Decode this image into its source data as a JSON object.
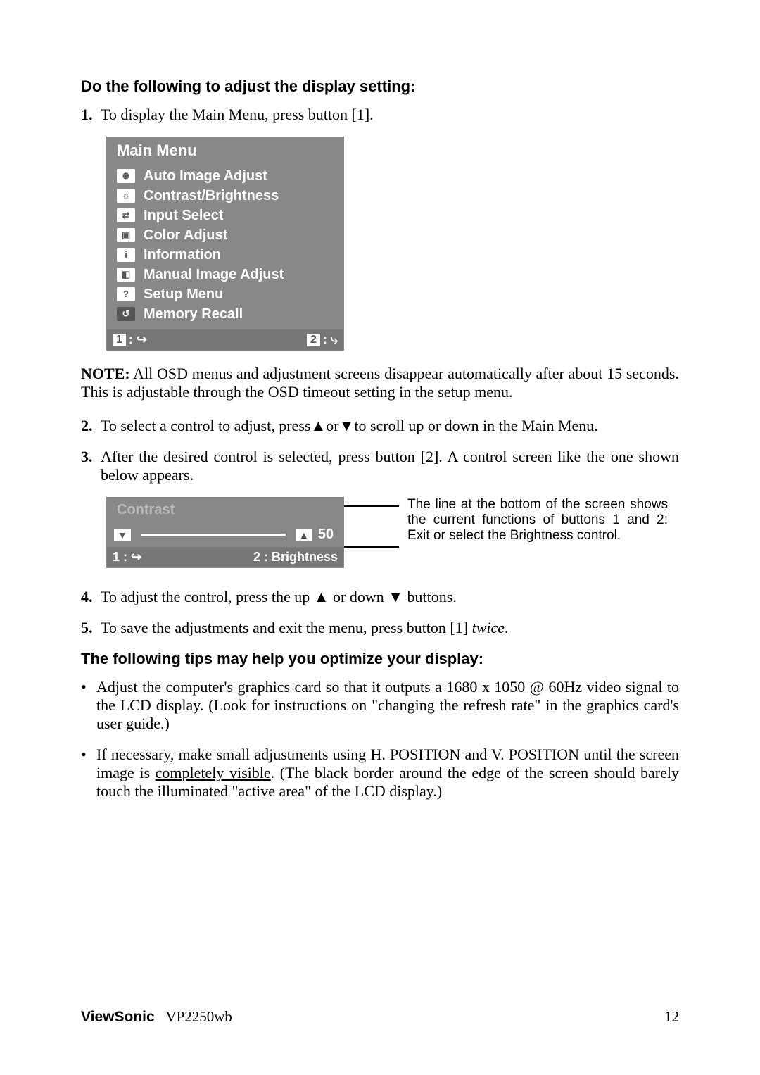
{
  "heading1": "Do the following to adjust the display setting:",
  "step1_num": "1.",
  "step1_text": "To display the Main Menu, press button [1].",
  "osd": {
    "title": "Main Menu",
    "items": [
      {
        "icon": "⊕",
        "label": "Auto Image Adjust"
      },
      {
        "icon": "☼",
        "label": "Contrast/Brightness"
      },
      {
        "icon": "⇄",
        "label": "Input Select"
      },
      {
        "icon": "▣",
        "label": "Color Adjust"
      },
      {
        "icon": "i",
        "label": "Information"
      },
      {
        "icon": "◧",
        "label": "Manual Image Adjust"
      },
      {
        "icon": "?",
        "label": "Setup Menu"
      },
      {
        "icon": "↺",
        "label": "Memory Recall"
      }
    ],
    "footer_key1": "1",
    "footer_sym1": ": ↪",
    "footer_key2": "2",
    "footer_sym2": ": ⤷"
  },
  "note_label": "NOTE:",
  "note_text": " All OSD menus and adjustment screens disappear automatically after about 15 seconds. This is adjustable through the OSD timeout setting in the setup menu.",
  "step2_num": "2.",
  "step2_a": "To select a control to adjust, press",
  "step2_b": "or",
  "step2_c": "to scroll up or down in the Main Menu.",
  "step3_num": "3.",
  "step3_text": "After the desired control is selected, press button [2]. A control screen like the one shown below appears.",
  "contrast": {
    "title": "Contrast",
    "value": "50",
    "footer_key1": "1",
    "footer_sym1": ": ↪",
    "footer_key2": "2",
    "footer_label2": ": Brightness"
  },
  "callout": "The line at the bottom of the screen shows the current functions of buttons 1 and 2: Exit or select the Brightness control.",
  "step4_num": "4.",
  "step4_a": "To adjust the control, press the up ",
  "step4_b": " or down ",
  "step4_c": " buttons.",
  "step5_num": "5.",
  "step5_a": "To save the adjustments and exit the menu, press button [1] ",
  "step5_b": "twice",
  "step5_c": ".",
  "heading2": "The following tips may help you optimize your display:",
  "tip1": "Adjust the computer's graphics card so that it outputs a 1680 x 1050 @ 60Hz video signal to the LCD display. (Look for instructions on \"changing the refresh rate\" in the graphics card's user guide.)",
  "tip2_a": "If necessary, make small adjustments using H. POSITION and V. POSITION until the screen image is ",
  "tip2_b": "completely visible",
  "tip2_c": ". (The black border around the edge of the screen should barely touch the illuminated \"active area\" of the LCD display.)",
  "footer_brand": "ViewSonic",
  "footer_model": "VP2250wb",
  "footer_page": "12"
}
